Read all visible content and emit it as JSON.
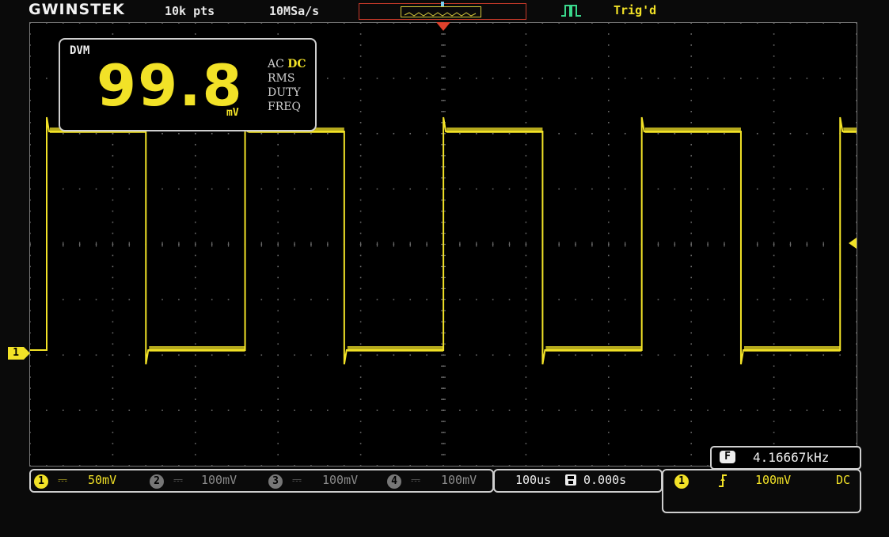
{
  "header": {
    "brand": "GWINSTEK",
    "record_length": "10k pts",
    "sample_rate": "10MSa/s",
    "trigger_status": "Trig'd"
  },
  "dvm": {
    "label": "DVM",
    "value": "99.8",
    "unit": "mV",
    "mode_ac": "AC",
    "mode_dc": "DC",
    "mode_rms": "RMS",
    "mode_duty": "DUTY",
    "mode_freq": "FREQ"
  },
  "frequency_counter": {
    "icon_label": "F",
    "value": "4.16667kHz"
  },
  "channels": [
    {
      "number": "1",
      "coupling": "⎓",
      "scale": "50mV",
      "active": true
    },
    {
      "number": "2",
      "coupling": "⎓",
      "scale": "100mV",
      "active": false
    },
    {
      "number": "3",
      "coupling": "⎓",
      "scale": "100mV",
      "active": false
    },
    {
      "number": "4",
      "coupling": "⎓",
      "scale": "100mV",
      "active": false
    }
  ],
  "timebase": {
    "scale": "100us",
    "position": "0.000s"
  },
  "trigger": {
    "source": "1",
    "slope_icon": "rising-edge",
    "level": "100mV",
    "coupling": "DC"
  },
  "ground_marker": "1",
  "colors": {
    "trace": "#f2e227",
    "trigger_marker": "#e0412c",
    "grid": "#6a6a6a"
  }
}
